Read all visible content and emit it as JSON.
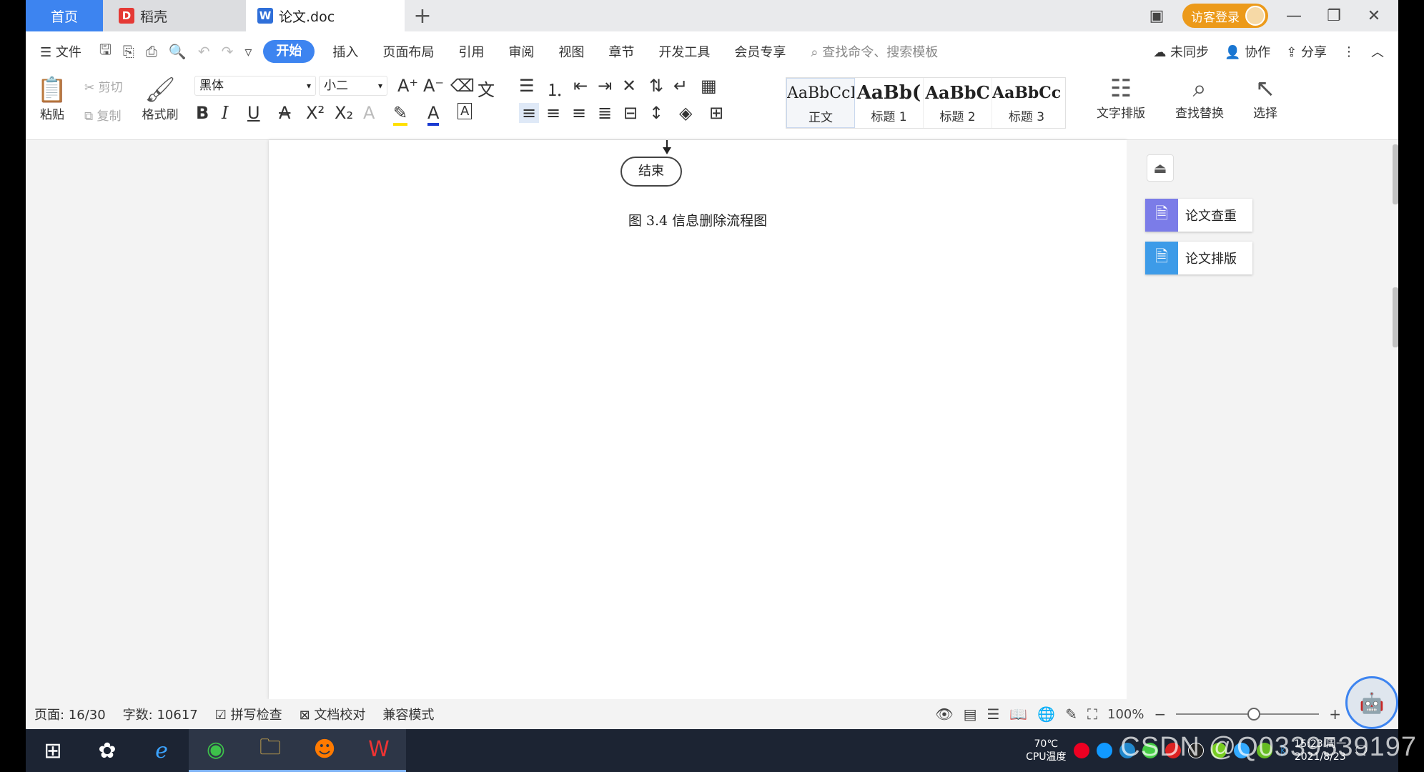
{
  "tabs": {
    "home": "首页",
    "daoke": "稻壳",
    "doc": "论文.doc",
    "add": "+"
  },
  "login": {
    "label": "访客登录"
  },
  "window_controls": {
    "minimize": "—",
    "restore": "❐",
    "close": "✕"
  },
  "menu": {
    "file": "文件",
    "items": [
      "开始",
      "插入",
      "页面布局",
      "引用",
      "审阅",
      "视图",
      "章节",
      "开发工具",
      "会员专享"
    ],
    "search_placeholder": "查找命令、搜索模板",
    "right": [
      "未同步",
      "协作",
      "分享"
    ]
  },
  "toolbar": {
    "paste": "粘贴",
    "cut": "剪切",
    "copy": "复制",
    "format_painter": "格式刷",
    "font": "黑体",
    "size": "小二",
    "styles": [
      {
        "preview": "AaBbCcI",
        "name": "正文"
      },
      {
        "preview": "AaBb(",
        "name": "标题 1"
      },
      {
        "preview": "AaBbC",
        "name": "标题 2"
      },
      {
        "preview": "AaBbCcl",
        "name": "标题 3"
      }
    ],
    "text_layout": "文字排版",
    "find_replace": "查找替换",
    "select": "选择"
  },
  "document": {
    "end_node": "结束",
    "caption": "图 3.4  信息删除流程图"
  },
  "side_panel": {
    "check": "论文查重",
    "format": "论文排版"
  },
  "status": {
    "page": "页面: 16/30",
    "words": "字数: 10617",
    "spell": "拼写检查",
    "proof": "文档校对",
    "compat": "兼容模式",
    "zoom": "100%"
  },
  "taskbar": {
    "cpu_temp": "70℃",
    "cpu_label": "CPU温度",
    "time": "15:23 周一",
    "date": "2021/8/23"
  },
  "watermark": "CSDN @Q0339539197"
}
